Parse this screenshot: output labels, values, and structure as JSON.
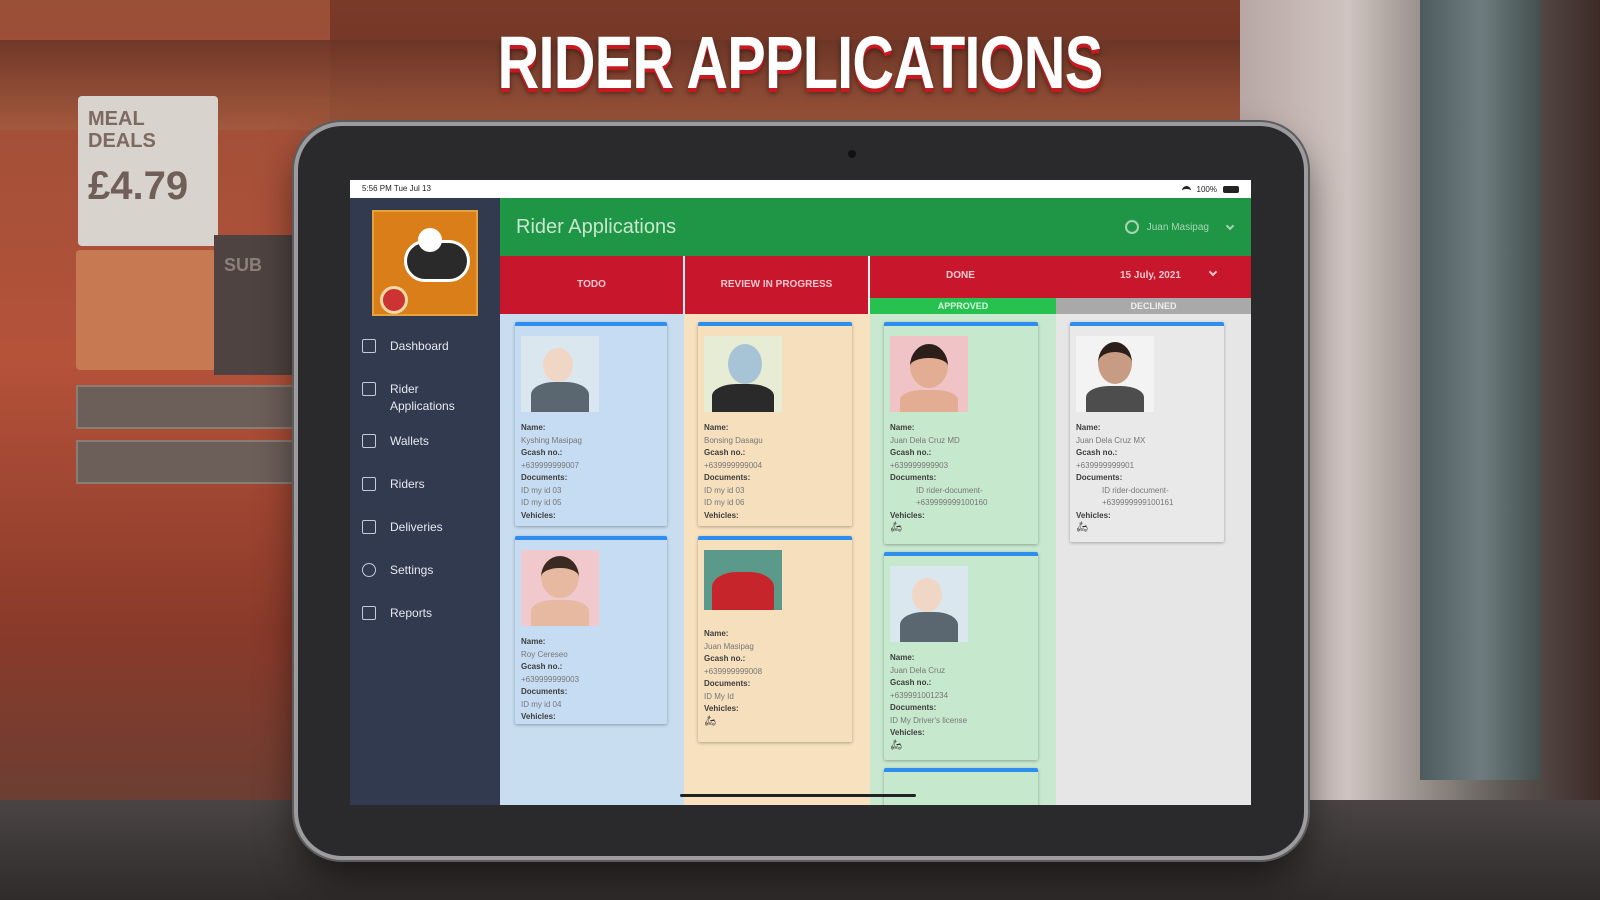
{
  "hero": {
    "title": "RIDER APPLICATIONS"
  },
  "background": {
    "poster_top": "MEAL DEALS",
    "poster_price": "£4.79",
    "sign": "SUB"
  },
  "status_bar": {
    "time": "5:56 PM  Tue Jul 13",
    "battery": "100%"
  },
  "sidebar": {
    "items": [
      {
        "label": "Dashboard",
        "icon": "dashboard-icon"
      },
      {
        "label": "Rider\nApplications",
        "icon": "applications-icon"
      },
      {
        "label": "Wallets",
        "icon": "wallet-icon"
      },
      {
        "label": "Riders",
        "icon": "riders-icon"
      },
      {
        "label": "Deliveries",
        "icon": "bike-icon"
      },
      {
        "label": "Settings",
        "icon": "gear-icon"
      },
      {
        "label": "Reports",
        "icon": "reports-icon"
      }
    ]
  },
  "header": {
    "title": "Rider Applications",
    "user": "Juan Masipag"
  },
  "columns": {
    "todo": "TODO",
    "review": "REVIEW IN PROGRESS",
    "done": "DONE",
    "date": "15 July, 2021",
    "approved": "APPROVED",
    "declined": "DECLINED"
  },
  "labels": {
    "name": "Name:",
    "gcash": "Gcash no.:",
    "documents": "Documents:",
    "vehicles": "Vehicles:"
  },
  "cards": {
    "todo": [
      {
        "name": "Kyshing Masipag",
        "gcash": "+639999999007",
        "docs": [
          "ID my id 03",
          "ID my id 05"
        ],
        "vehicle": false
      },
      {
        "name": "Roy Cereseo",
        "gcash": "+639999999003",
        "docs": [
          "ID my id 04"
        ],
        "vehicle": false
      }
    ],
    "review": [
      {
        "name": "Bonsing Dasagu",
        "gcash": "+639999999004",
        "docs": [
          "ID my id 03",
          "ID my id 06"
        ],
        "vehicle": false
      },
      {
        "name": "Juan Masipag",
        "gcash": "+639999999008",
        "docs": [
          "ID My Id"
        ],
        "vehicle": true
      }
    ],
    "approved": [
      {
        "name": "Juan Dela Cruz MD",
        "gcash": "+639999999903",
        "docs": [
          "ID rider-document-",
          "+639999999100160"
        ],
        "vehicle": true
      },
      {
        "name": "Juan Dela Cruz",
        "gcash": "+639991001234",
        "docs": [
          "ID My Driver's license"
        ],
        "vehicle": true
      }
    ],
    "declined": [
      {
        "name": "Juan Dela Cruz MX",
        "gcash": "+639999999901",
        "docs": [
          "ID rider-document-",
          "+639999999100161"
        ],
        "vehicle": true
      }
    ]
  }
}
